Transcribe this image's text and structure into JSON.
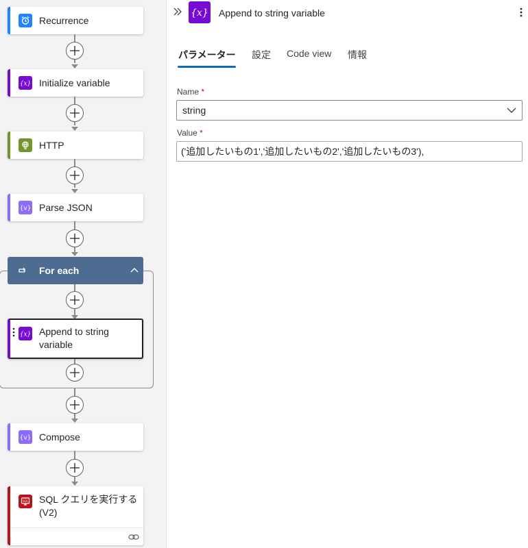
{
  "flow": {
    "recurrence": "Recurrence",
    "initialize_variable": "Initialize variable",
    "http": "HTTP",
    "parse_json": "Parse JSON",
    "for_each": "For each",
    "append_string": "Append to string variable",
    "append_string_line1": "Append to string",
    "append_string_line2": "variable",
    "compose": "Compose",
    "sql_line1": "SQL クエリを実行する",
    "sql_line2": "(V2)"
  },
  "panel": {
    "title": "Append to string variable",
    "tabs": [
      "パラメーター",
      "設定",
      "Code view",
      "情報"
    ],
    "active_tab": "パラメーター",
    "name_label": "Name",
    "name_value": "string",
    "value_label": "Value",
    "value_value": "('追加したいもの1','追加したいもの2','追加したいもの3'),",
    "required_mark": "*"
  },
  "colors": {
    "recurrence": "#1f85ff",
    "variable": "#770bd6",
    "http": "#709727",
    "data_ops": "#8c6cff",
    "foreach": "#4e6b91",
    "sql": "#ba141a",
    "active_tab_underline": "#0f6cbd"
  },
  "icons": [
    "expand-panel-icon",
    "alarm-clock-icon",
    "variable-icon",
    "globe-icon",
    "braces-icon",
    "loop-icon",
    "chevron-up-icon",
    "plus-icon",
    "database-icon",
    "link-icon",
    "more-vertical-icon",
    "chevron-down-icon",
    "drag-handle-icon"
  ]
}
